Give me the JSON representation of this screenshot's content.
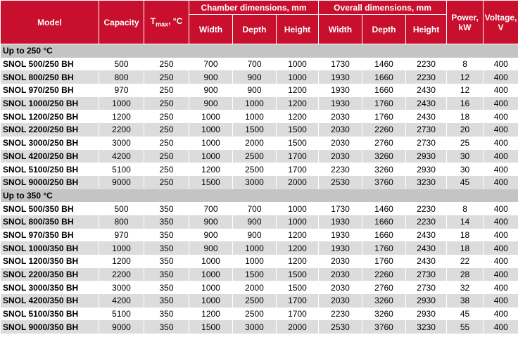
{
  "header": {
    "model": "Model",
    "capacity": "Capacity",
    "tmax_main": "T",
    "tmax_sub": "max",
    "tmax_unit": ", °C",
    "chamber_group": "Chamber dimensions, mm",
    "overall_group": "Overall dimensions, mm",
    "width": "Width",
    "depth": "Depth",
    "height": "Height",
    "power": "Power, kW",
    "voltage": "Voltage, V"
  },
  "sections": [
    {
      "title": "Up to 250 °C",
      "rows": [
        [
          "SNOL 500/250 BH",
          "500",
          "250",
          "700",
          "700",
          "1000",
          "1730",
          "1460",
          "2230",
          "8",
          "400"
        ],
        [
          "SNOL 800/250 BH",
          "800",
          "250",
          "900",
          "900",
          "1000",
          "1930",
          "1660",
          "2230",
          "12",
          "400"
        ],
        [
          "SNOL 970/250 BH",
          "970",
          "250",
          "900",
          "900",
          "1200",
          "1930",
          "1660",
          "2430",
          "12",
          "400"
        ],
        [
          "SNOL 1000/250 BH",
          "1000",
          "250",
          "900",
          "1000",
          "1200",
          "1930",
          "1760",
          "2430",
          "16",
          "400"
        ],
        [
          "SNOL 1200/250 BH",
          "1200",
          "250",
          "1000",
          "1000",
          "1200",
          "2030",
          "1760",
          "2430",
          "18",
          "400"
        ],
        [
          "SNOL 2200/250 BH",
          "2200",
          "250",
          "1000",
          "1500",
          "1500",
          "2030",
          "2260",
          "2730",
          "20",
          "400"
        ],
        [
          "SNOL 3000/250 BH",
          "3000",
          "250",
          "1000",
          "2000",
          "1500",
          "2030",
          "2760",
          "2730",
          "25",
          "400"
        ],
        [
          "SNOL 4200/250 BH",
          "4200",
          "250",
          "1000",
          "2500",
          "1700",
          "2030",
          "3260",
          "2930",
          "30",
          "400"
        ],
        [
          "SNOL 5100/250 BH",
          "5100",
          "250",
          "1200",
          "2500",
          "1700",
          "2230",
          "3260",
          "2930",
          "30",
          "400"
        ],
        [
          "SNOL 9000/250 BH",
          "9000",
          "250",
          "1500",
          "3000",
          "2000",
          "2530",
          "3760",
          "3230",
          "45",
          "400"
        ]
      ]
    },
    {
      "title": "Up to 350 °C",
      "rows": [
        [
          "SNOL 500/350 BH",
          "500",
          "350",
          "700",
          "700",
          "1000",
          "1730",
          "1460",
          "2230",
          "8",
          "400"
        ],
        [
          "SNOL 800/350 BH",
          "800",
          "350",
          "900",
          "900",
          "1000",
          "1930",
          "1660",
          "2230",
          "14",
          "400"
        ],
        [
          "SNOL 970/350 BH",
          "970",
          "350",
          "900",
          "900",
          "1200",
          "1930",
          "1660",
          "2430",
          "18",
          "400"
        ],
        [
          "SNOL 1000/350 BH",
          "1000",
          "350",
          "900",
          "1000",
          "1200",
          "1930",
          "1760",
          "2430",
          "18",
          "400"
        ],
        [
          "SNOL 1200/350 BH",
          "1200",
          "350",
          "1000",
          "1000",
          "1200",
          "2030",
          "1760",
          "2430",
          "22",
          "400"
        ],
        [
          "SNOL 2200/350 BH",
          "2200",
          "350",
          "1000",
          "1500",
          "1500",
          "2030",
          "2260",
          "2730",
          "28",
          "400"
        ],
        [
          "SNOL 3000/350 BH",
          "3000",
          "350",
          "1000",
          "2000",
          "1500",
          "2030",
          "2760",
          "2730",
          "32",
          "400"
        ],
        [
          "SNOL 4200/350 BH",
          "4200",
          "350",
          "1000",
          "2500",
          "1700",
          "2030",
          "3260",
          "2930",
          "38",
          "400"
        ],
        [
          "SNOL 5100/350 BH",
          "5100",
          "350",
          "1200",
          "2500",
          "1700",
          "2230",
          "3260",
          "2930",
          "45",
          "400"
        ],
        [
          "SNOL 9000/350 BH",
          "9000",
          "350",
          "1500",
          "3000",
          "2000",
          "2530",
          "3760",
          "3230",
          "55",
          "400"
        ]
      ]
    }
  ],
  "colors": {
    "header_bg": "#c8102e",
    "section_bg": "#c4c4c4",
    "stripe_bg": "#dcdcdc"
  }
}
